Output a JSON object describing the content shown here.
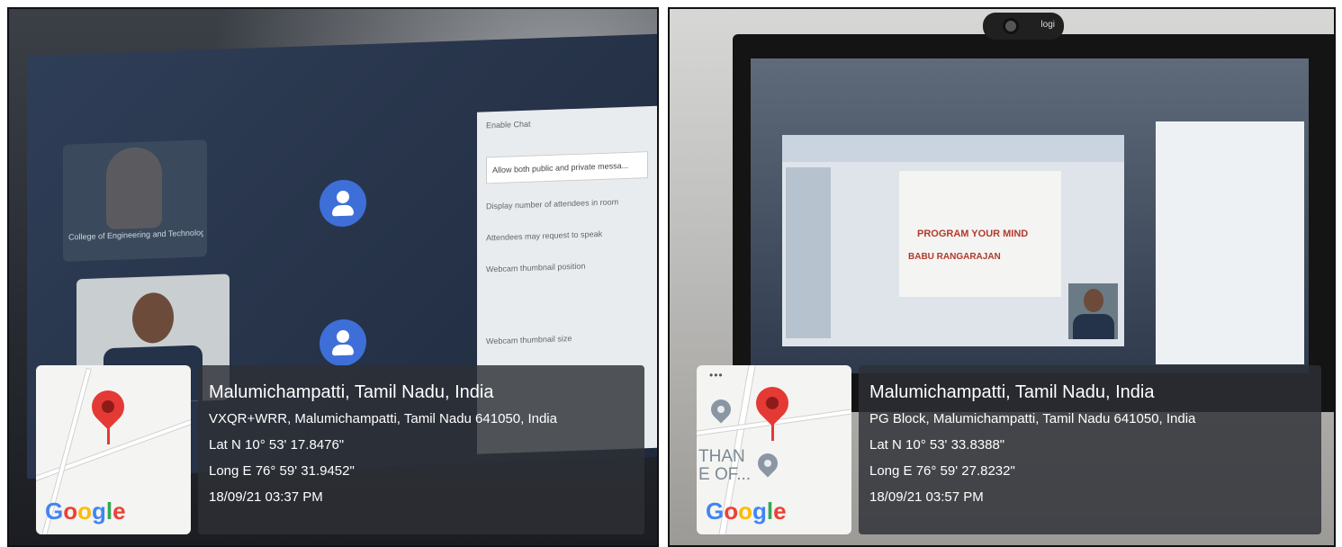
{
  "photos": [
    {
      "location": "Malumichampatti, Tamil Nadu, India",
      "address": "VXQR+WRR, Malumichampatti, Tamil Nadu 641050, India",
      "latitude": "Lat N 10° 53' 17.8476\"",
      "longitude": "Long E 76° 59' 31.9452\"",
      "datetime": "18/09/21 03:37 PM",
      "map_brand": "Google",
      "pin_color": "#e53935"
    },
    {
      "location": "Malumichampatti, Tamil Nadu, India",
      "address": "PG Block, Malumichampatti, Tamil Nadu 641050, India",
      "latitude": "Lat N 10° 53' 33.8388\"",
      "longitude": "Long E 76° 59' 27.8232\"",
      "datetime": "18/09/21 03:57 PM",
      "map_brand": "Google",
      "map_place": "THAN\nE OF...",
      "map_menu": "•••",
      "webcam_brand": "logi",
      "slide_title": "PROGRAM YOUR MIND",
      "slide_speaker": "BABU RANGARAJAN",
      "pin_color": "#e53935"
    }
  ],
  "left_screen": {
    "tile_caption": "College of Engineering and Technology",
    "panel": {
      "enable_chat": "Enable Chat",
      "allow_msgs": "Allow both public and private messa...",
      "display_count": "Display number of attendees in room",
      "request_speak": "Attendees may request to speak",
      "thumb_position": "Webcam thumbnail position",
      "thumb_size": "Webcam thumbnail size"
    }
  }
}
